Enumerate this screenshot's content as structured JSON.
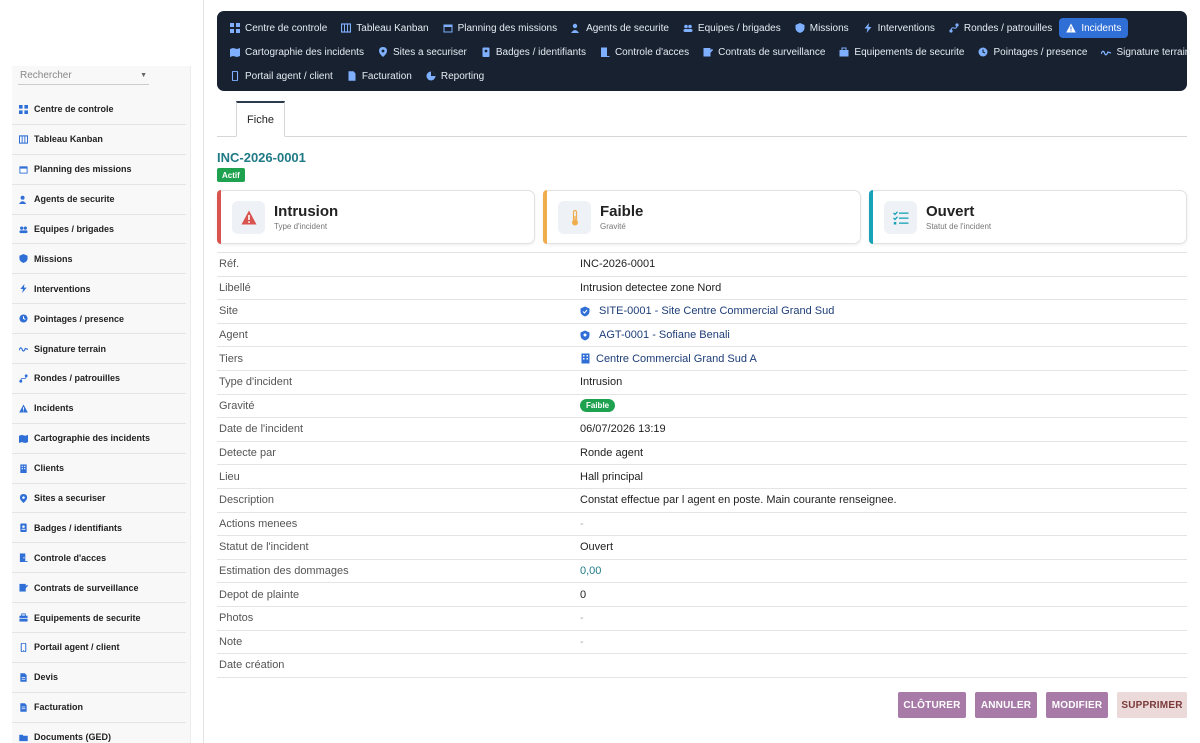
{
  "sidebar": {
    "search_placeholder": "Rechercher",
    "items": [
      {
        "label": "Centre de controle",
        "icon": "grid-icon"
      },
      {
        "label": "Tableau Kanban",
        "icon": "kanban-icon"
      },
      {
        "label": "Planning des missions",
        "icon": "calendar-icon"
      },
      {
        "label": "Agents de securite",
        "icon": "user-shield-icon"
      },
      {
        "label": "Equipes / brigades",
        "icon": "users-icon"
      },
      {
        "label": "Missions",
        "icon": "shield-icon"
      },
      {
        "label": "Interventions",
        "icon": "bolt-icon"
      },
      {
        "label": "Pointages / presence",
        "icon": "clock-icon"
      },
      {
        "label": "Signature terrain",
        "icon": "signature-icon"
      },
      {
        "label": "Rondes / patrouilles",
        "icon": "route-icon"
      },
      {
        "label": "Incidents",
        "icon": "warning-icon"
      },
      {
        "label": "Cartographie des incidents",
        "icon": "map-icon"
      },
      {
        "label": "Clients",
        "icon": "building-icon"
      },
      {
        "label": "Sites a securiser",
        "icon": "pin-icon"
      },
      {
        "label": "Badges / identifiants",
        "icon": "badge-icon"
      },
      {
        "label": "Controle d'acces",
        "icon": "door-icon"
      },
      {
        "label": "Contrats de surveillance",
        "icon": "contract-icon"
      },
      {
        "label": "Equipements de securite",
        "icon": "toolbox-icon"
      },
      {
        "label": "Portail agent / client",
        "icon": "mobile-icon"
      },
      {
        "label": "Devis",
        "icon": "file-icon"
      },
      {
        "label": "Facturation",
        "icon": "invoice-icon"
      },
      {
        "label": "Documents (GED)",
        "icon": "folder-icon"
      }
    ]
  },
  "topnav": {
    "rows": [
      [
        {
          "label": "Centre de controle",
          "icon": "grid-icon"
        },
        {
          "label": "Tableau Kanban",
          "icon": "kanban-icon"
        },
        {
          "label": "Planning des missions",
          "icon": "calendar-icon"
        },
        {
          "label": "Agents de securite",
          "icon": "user-shield-icon"
        },
        {
          "label": "Equipes / brigades",
          "icon": "users-icon"
        },
        {
          "label": "Missions",
          "icon": "shield-icon"
        },
        {
          "label": "Interventions",
          "icon": "bolt-icon"
        },
        {
          "label": "Rondes / patrouilles",
          "icon": "route-icon"
        },
        {
          "label": "Incidents",
          "icon": "warning-icon",
          "active": true
        }
      ],
      [
        {
          "label": "Cartographie des incidents",
          "icon": "map-icon"
        },
        {
          "label": "Sites a securiser",
          "icon": "pin-icon"
        },
        {
          "label": "Badges / identifiants",
          "icon": "badge-icon"
        },
        {
          "label": "Controle d'acces",
          "icon": "door-icon"
        },
        {
          "label": "Contrats de surveillance",
          "icon": "contract-icon"
        },
        {
          "label": "Equipements de securite",
          "icon": "toolbox-icon"
        },
        {
          "label": "Pointages / presence",
          "icon": "clock-icon"
        },
        {
          "label": "Signature terrain",
          "icon": "signature-icon"
        }
      ],
      [
        {
          "label": "Portail agent / client",
          "icon": "mobile-icon"
        },
        {
          "label": "Facturation",
          "icon": "invoice-icon"
        },
        {
          "label": "Reporting",
          "icon": "chart-icon"
        }
      ]
    ]
  },
  "tabs": {
    "fiche": "Fiche"
  },
  "record": {
    "ref": "INC-2026-0001",
    "status": "Actif"
  },
  "cards": [
    {
      "value": "Intrusion",
      "label": "Type d'incident",
      "icon": "warning-icon",
      "accent": "#d9534f"
    },
    {
      "value": "Faible",
      "label": "Gravité",
      "icon": "thermometer-icon",
      "accent": "#f0ad4e"
    },
    {
      "value": "Ouvert",
      "label": "Statut de l'incident",
      "icon": "checklist-icon",
      "accent": "#17a2b8"
    }
  ],
  "fields": {
    "ref": {
      "label": "Réf.",
      "value": "INC-2026-0001"
    },
    "libelle": {
      "label": "Libellé",
      "value": "Intrusion detectee zone Nord"
    },
    "site": {
      "label": "Site",
      "value": "SITE-0001 - Site Centre Commercial Grand Sud"
    },
    "agent": {
      "label": "Agent",
      "value": "AGT-0001 - Sofiane Benali"
    },
    "tiers": {
      "label": "Tiers",
      "value": "Centre Commercial Grand Sud A"
    },
    "type": {
      "label": "Type d'incident",
      "value": "Intrusion"
    },
    "gravite": {
      "label": "Gravité",
      "value": "Faible"
    },
    "date": {
      "label": "Date de l'incident",
      "value": "06/07/2026 13:19"
    },
    "detecte": {
      "label": "Detecte par",
      "value": "Ronde agent"
    },
    "lieu": {
      "label": "Lieu",
      "value": "Hall principal"
    },
    "description": {
      "label": "Description",
      "value": "Constat effectue par l agent en poste. Main courante renseignee."
    },
    "actions": {
      "label": "Actions menees",
      "value": "-"
    },
    "statut": {
      "label": "Statut de l'incident",
      "value": "Ouvert"
    },
    "estimation": {
      "label": "Estimation des dommages",
      "value": "0,00"
    },
    "plainte": {
      "label": "Depot de plainte",
      "value": "0"
    },
    "photos": {
      "label": "Photos",
      "value": "-"
    },
    "note": {
      "label": "Note",
      "value": "-"
    },
    "creation": {
      "label": "Date création",
      "value": ""
    }
  },
  "actions": {
    "cloturer": "CLÔTURER",
    "annuler": "ANNULER",
    "modifier": "MODIFIER",
    "supprimer": "SUPPRIMER"
  },
  "colors": {
    "nav_bg": "#172130",
    "nav_active": "#2f6fd6",
    "accent_teal": "#1f7a85",
    "badge_green": "#1ea24f",
    "button_purple": "#a77aa8"
  }
}
